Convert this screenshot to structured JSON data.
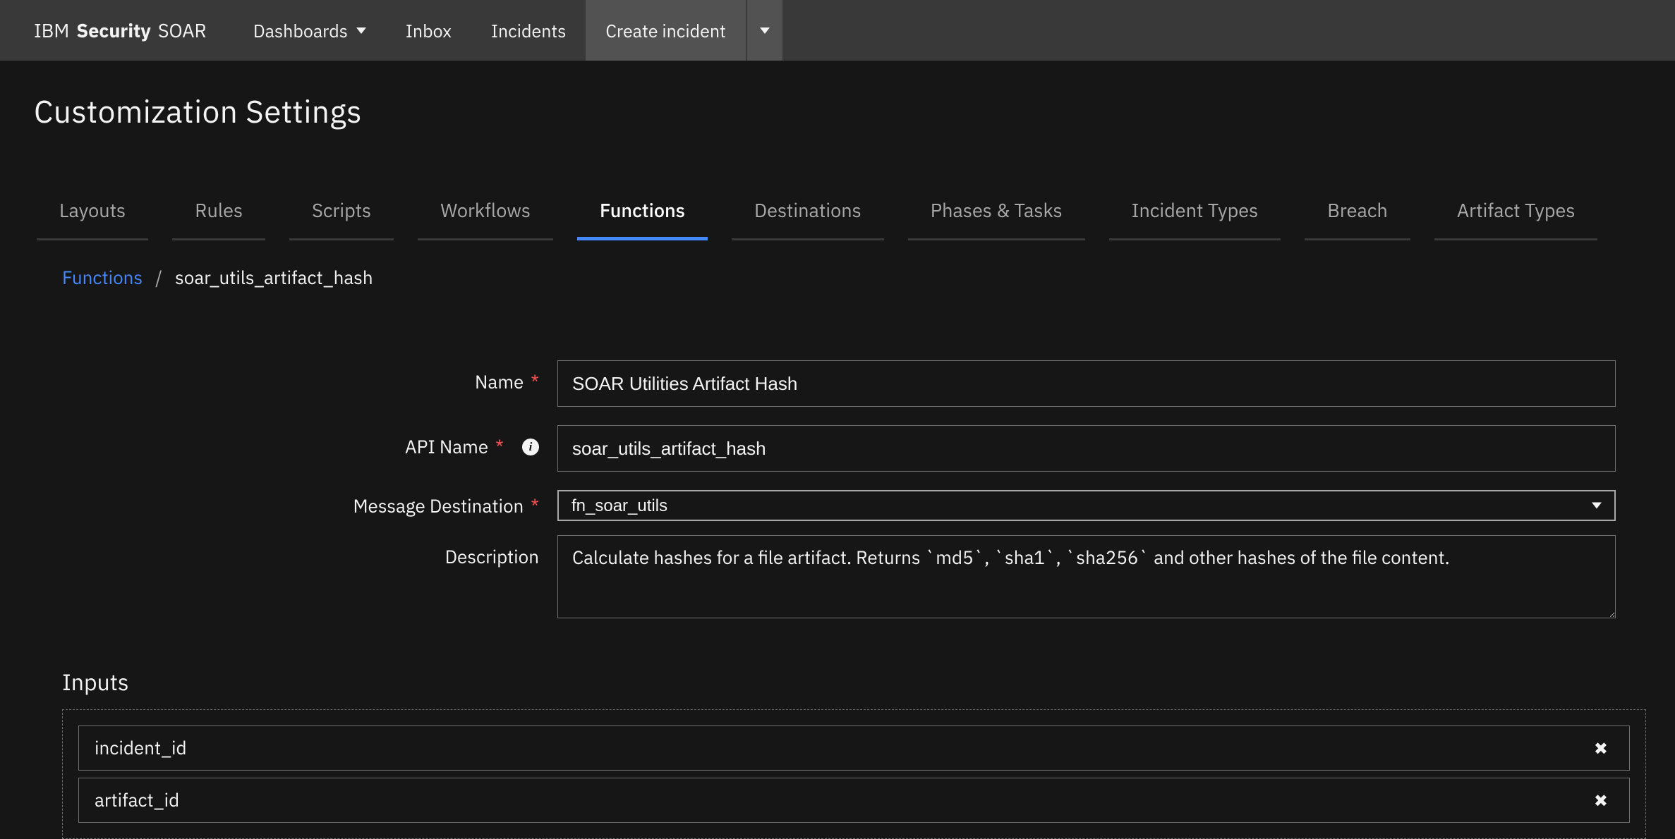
{
  "brand": {
    "ibm": "IBM",
    "security": "Security",
    "soar": "SOAR"
  },
  "nav": {
    "dashboards": "Dashboards",
    "inbox": "Inbox",
    "incidents": "Incidents",
    "create_incident": "Create incident"
  },
  "page": {
    "title": "Customization Settings"
  },
  "tabs": {
    "layouts": "Layouts",
    "rules": "Rules",
    "scripts": "Scripts",
    "workflows": "Workflows",
    "functions": "Functions",
    "destinations": "Destinations",
    "phases_tasks": "Phases & Tasks",
    "incident_types": "Incident Types",
    "breach": "Breach",
    "artifact_types": "Artifact Types"
  },
  "breadcrumb": {
    "root": "Functions",
    "sep": "/",
    "current": "soar_utils_artifact_hash"
  },
  "form": {
    "labels": {
      "name": "Name",
      "api_name": "API Name",
      "message_destination": "Message Destination",
      "description": "Description",
      "required_mark": "*",
      "info_glyph": "i"
    },
    "values": {
      "name": "SOAR Utilities Artifact Hash",
      "api_name": "soar_utils_artifact_hash",
      "message_destination": "fn_soar_utils",
      "description": "Calculate hashes for a file artifact. Returns `md5`, `sha1`, `sha256` and other hashes of the file content."
    }
  },
  "inputs": {
    "title": "Inputs",
    "items": [
      "incident_id",
      "artifact_id"
    ],
    "remove_glyph": "✖"
  }
}
